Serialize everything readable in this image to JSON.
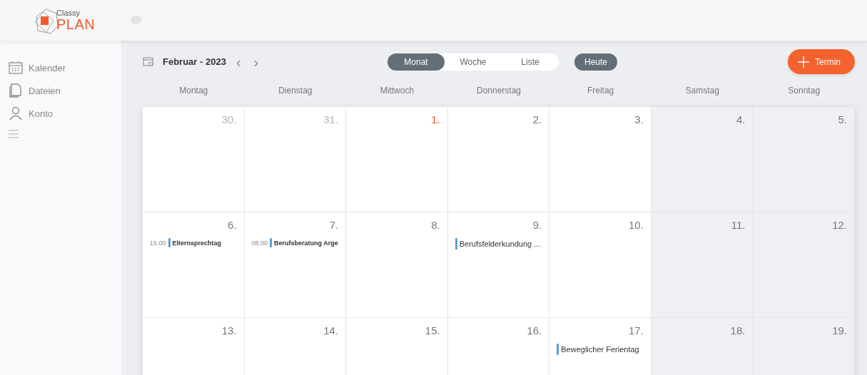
{
  "logo": {
    "line_1": "Classy",
    "line_2": "PLAN"
  },
  "sidebar": {
    "items": [
      {
        "label": "Kalender"
      },
      {
        "label": "Dateien"
      },
      {
        "label": "Konto"
      }
    ]
  },
  "toolbar": {
    "title": "Februar - 2023",
    "prev": "‹",
    "next": "›",
    "views": [
      {
        "label": "Monat",
        "selected": true
      },
      {
        "label": "Woche",
        "selected": false
      },
      {
        "label": "Liste",
        "selected": false
      }
    ],
    "today_button": "Heute",
    "add_button": "Termin"
  },
  "calendar": {
    "weekdays": [
      {
        "label": "Montag",
        "weekend": false
      },
      {
        "label": "Dienstag",
        "weekend": false
      },
      {
        "label": "Mittwoch",
        "weekend": false
      },
      {
        "label": "Donnerstag",
        "weekend": false
      },
      {
        "label": "Freitag",
        "weekend": false
      },
      {
        "label": "Samstag",
        "weekend": true
      },
      {
        "label": "Sonntag",
        "weekend": true
      }
    ],
    "weeks": [
      {
        "days": [
          {
            "number": "30.",
            "kind": "other"
          },
          {
            "number": "31.",
            "kind": "other"
          },
          {
            "number": "1.",
            "kind": "today"
          },
          {
            "number": "2.",
            "kind": "normal"
          },
          {
            "number": "3.",
            "kind": "normal"
          },
          {
            "number": "4.",
            "kind": "normal"
          },
          {
            "number": "5.",
            "kind": "normal"
          }
        ]
      },
      {
        "days": [
          {
            "number": "6.",
            "kind": "normal",
            "events": [
              {
                "kind": "timed",
                "time": "15.00",
                "title": "Elternsprechtag",
                "color": "#5b9fd1"
              }
            ]
          },
          {
            "number": "7.",
            "kind": "normal",
            "events": [
              {
                "kind": "timed",
                "time": "08.00",
                "title": "Berufsberatung Arge",
                "color": "#5b9fd1"
              }
            ]
          },
          {
            "number": "8.",
            "kind": "normal"
          },
          {
            "number": "9.",
            "kind": "normal",
            "events": [
              {
                "kind": "allday",
                "title": "Berufsfelderkundung ...",
                "color": "#5b9fd1"
              }
            ]
          },
          {
            "number": "10.",
            "kind": "normal"
          },
          {
            "number": "11.",
            "kind": "normal"
          },
          {
            "number": "12.",
            "kind": "normal"
          }
        ]
      },
      {
        "days": [
          {
            "number": "13.",
            "kind": "normal"
          },
          {
            "number": "14.",
            "kind": "normal"
          },
          {
            "number": "15.",
            "kind": "normal"
          },
          {
            "number": "16.",
            "kind": "normal"
          },
          {
            "number": "17.",
            "kind": "normal",
            "events": [
              {
                "kind": "allday",
                "title": "Beweglicher Ferientag",
                "color": "#5b9fd1"
              }
            ]
          },
          {
            "number": "18.",
            "kind": "normal"
          },
          {
            "number": "19.",
            "kind": "normal"
          }
        ]
      }
    ]
  }
}
